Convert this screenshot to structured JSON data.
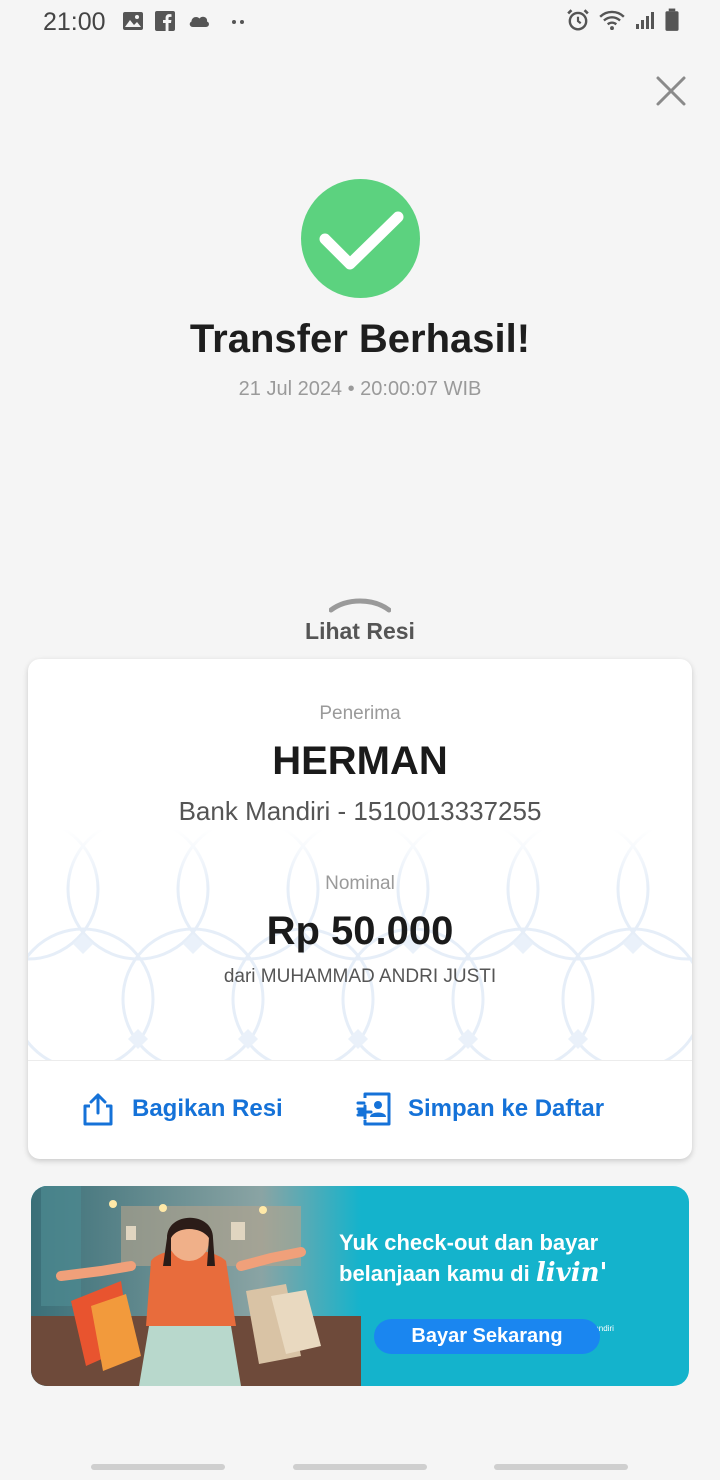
{
  "status_bar": {
    "time": "21:00",
    "left_icons": [
      "image-icon",
      "facebook-icon",
      "cloud-icon",
      "more-dots-icon"
    ],
    "right_icons": [
      "alarm-icon",
      "wifi-icon",
      "signal-icon",
      "battery-icon"
    ]
  },
  "header": {
    "close_icon": "close-icon"
  },
  "success": {
    "icon": "check-circle-icon",
    "icon_color": "#5cd27f",
    "title": "Transfer Berhasil!",
    "datetime": "21 Jul 2024 • 20:00:07 WIB"
  },
  "receipt_toggle": {
    "icon": "chevron-up-icon",
    "label": "Lihat Resi"
  },
  "card": {
    "recipient_label": "Penerima",
    "recipient_name": "HERMAN",
    "recipient_bank": "Bank Mandiri - 1510013337255",
    "amount_label": "Nominal",
    "amount": "Rp 50.000",
    "sender": "dari MUHAMMAD ANDRI JUSTI",
    "actions": {
      "share_label": "Bagikan Resi",
      "share_icon": "share-icon",
      "save_label": "Simpan ke Daftar",
      "save_icon": "add-contact-icon",
      "color": "#1572d8"
    }
  },
  "banner": {
    "line1": "Yuk check-out dan bayar",
    "line2_prefix": "belanjaan kamu di",
    "brand": "livin'",
    "brand_sub": "by mandiri",
    "cta": "Bayar Sekarang",
    "background": "#14b3cc",
    "cta_color": "#1a86f0"
  }
}
